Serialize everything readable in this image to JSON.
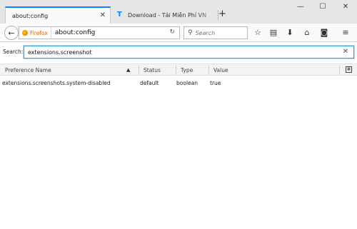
{
  "tabs": [
    {
      "title": "about:config",
      "active": true
    },
    {
      "title": "Download - Tải Miễn Phí VN",
      "active": false
    }
  ],
  "window_controls": {
    "minimize": "—",
    "maximize": "☐",
    "close": "✕"
  },
  "navbar": {
    "identity_label": "Firefox",
    "url": "about:config",
    "search_placeholder": "Search"
  },
  "config": {
    "search_label": "Search:",
    "search_value": "extensions.screenshot",
    "columns": [
      "Preference Name",
      "Status",
      "Type",
      "Value"
    ],
    "rows": [
      {
        "name": "extensions.screenshots.system-disabled",
        "status": "default",
        "type": "boolean",
        "value": "true"
      }
    ]
  }
}
